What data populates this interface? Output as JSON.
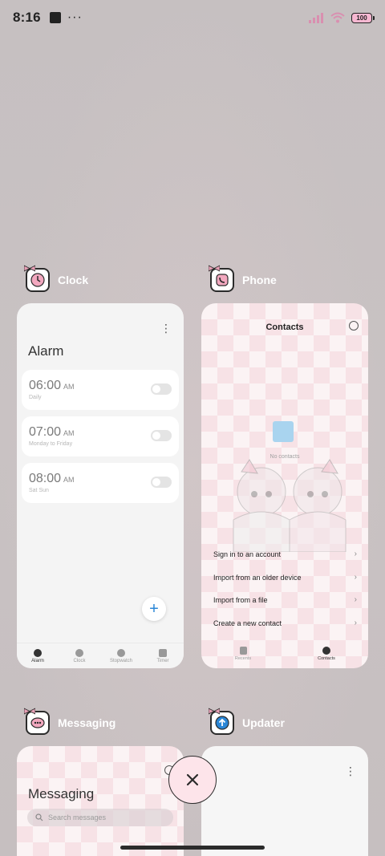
{
  "status_bar": {
    "time": "8:16",
    "dots": "···",
    "battery": "100"
  },
  "colors": {
    "accent_pink": "#f6b7d1",
    "close_fab_bg": "#fde4ea",
    "fab_plus": "#2a86d6"
  },
  "cards": {
    "clock": {
      "app_name": "Clock",
      "title": "Alarm",
      "alarms": [
        {
          "time": "06:00",
          "ampm": "AM",
          "repeat": "Daily"
        },
        {
          "time": "07:00",
          "ampm": "AM",
          "repeat": "Monday to Friday"
        },
        {
          "time": "08:00",
          "ampm": "AM",
          "repeat": "Sat Sun"
        }
      ],
      "add_label": "+",
      "nav": [
        "Alarm",
        "Clock",
        "Stopwatch",
        "Timer"
      ]
    },
    "phone": {
      "app_name": "Phone",
      "title": "Contacts",
      "empty_text": "No contacts",
      "actions": [
        "Sign in to an account",
        "Import from an older device",
        "Import from a file",
        "Create a new contact"
      ],
      "nav": [
        "Recents",
        "Contacts"
      ]
    },
    "messaging": {
      "app_name": "Messaging",
      "title": "Messaging",
      "search_placeholder": "Search messages"
    },
    "updater": {
      "app_name": "Updater"
    }
  },
  "icons": {
    "square": "notification-square-icon",
    "signal": "signal-icon",
    "wifi": "wifi-icon",
    "battery": "battery-icon",
    "close": "close-icon"
  }
}
